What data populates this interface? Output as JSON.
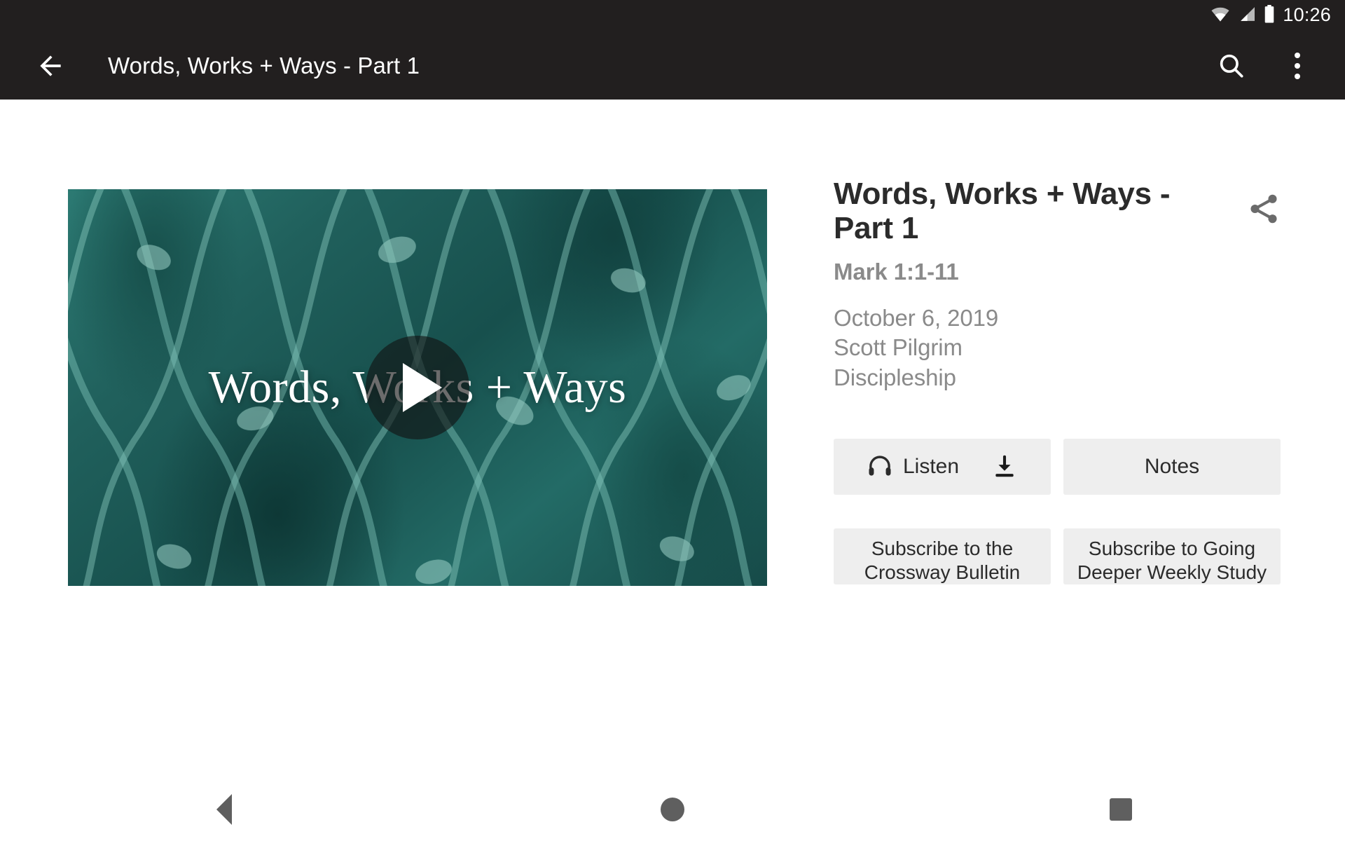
{
  "status_bar": {
    "time": "10:26",
    "icons": [
      "wifi-icon",
      "cell-signal-icon",
      "battery-icon"
    ]
  },
  "app_bar": {
    "back_icon": "back-arrow-icon",
    "title": "Words, Works + Ways - Part 1",
    "search_icon": "search-icon",
    "overflow_icon": "more-vertical-icon"
  },
  "video": {
    "overlay_title": "Words, Works + Ways",
    "play_icon": "play-icon"
  },
  "detail": {
    "title": "Words, Works + Ways - Part 1",
    "scripture": "Mark 1:1-11",
    "date": "October 6, 2019",
    "speaker": "Scott Pilgrim",
    "series": "Discipleship",
    "share_icon": "share-icon"
  },
  "actions": {
    "listen_label": "Listen",
    "listen_icon": "headphones-icon",
    "download_icon": "download-icon",
    "notes_label": "Notes",
    "subscribe_bulletin": "Subscribe to the Crossway Bulletin",
    "subscribe_study": "Subscribe to Going Deeper Weekly Study"
  },
  "nav_bar": {
    "back": "nav-back-icon",
    "home": "nav-home-icon",
    "recents": "nav-recents-icon"
  },
  "colors": {
    "app_bar_bg": "#221f1f",
    "page_bg": "#ffffff",
    "button_bg": "#eeeeee",
    "muted_text": "#8a8a8a",
    "primary_text": "#2b2b2b",
    "thumbnail_accent": "#20605c"
  }
}
